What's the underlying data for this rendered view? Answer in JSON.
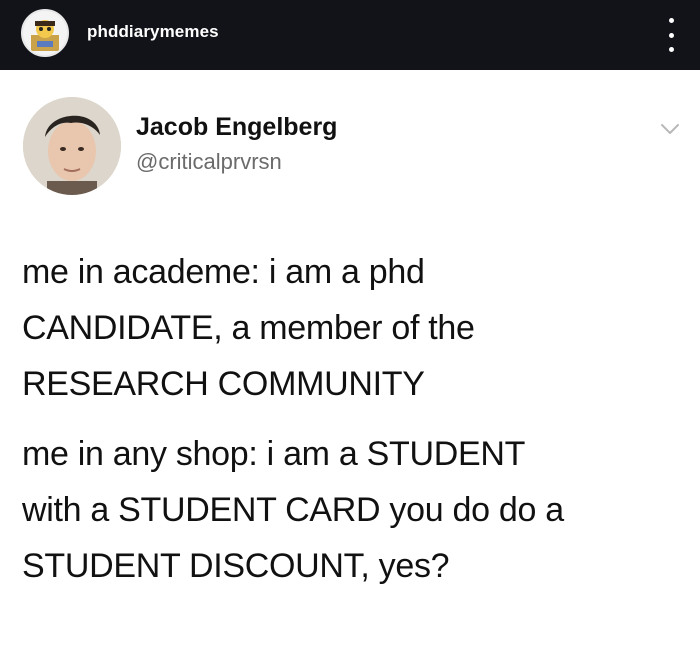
{
  "app_header": {
    "username": "phddiarymemes",
    "avatar_icon": "profile-avatar-icon",
    "menu_icon": "more-vertical-icon"
  },
  "tweet": {
    "display_name": "Jacob Engelberg",
    "handle": "@criticalprvrsn",
    "menu_icon": "chevron-down-icon",
    "paragraphs": [
      {
        "lines": [
          "me in academe: i am a phd",
          "CANDIDATE, a member of the",
          "RESEARCH COMMUNITY"
        ]
      },
      {
        "lines": [
          "me in any shop: i am a STUDENT",
          "with a STUDENT CARD you do do a",
          "STUDENT DISCOUNT, yes?"
        ]
      }
    ]
  },
  "colors": {
    "header_background": "#111318",
    "header_text": "#ffffff",
    "body_background": "#ffffff",
    "text_primary": "#111111",
    "text_secondary": "#6b6b6b"
  }
}
